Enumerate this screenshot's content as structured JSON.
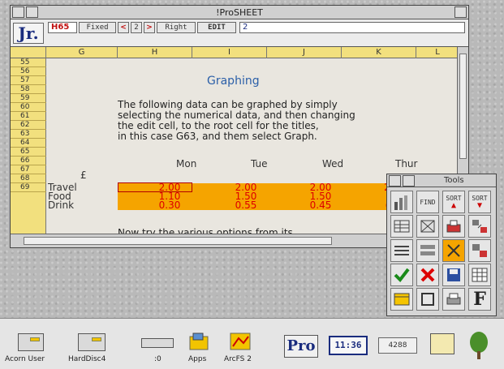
{
  "window": {
    "title": "!ProSHEET"
  },
  "infobar": {
    "logo": "Jr.",
    "cell_ref": "H65",
    "format_fixed": "Fixed",
    "arrow_left": "<",
    "decimals": "2",
    "arrow_right": ">",
    "align": "Right",
    "edit_label": "EDIT",
    "edit_value": "2"
  },
  "columns": [
    "G",
    "H",
    "I",
    "J",
    "K",
    "L"
  ],
  "rows": [
    "55",
    "56",
    "57",
    "58",
    "59",
    "60",
    "61",
    "62",
    "63",
    "64",
    "65",
    "66",
    "67",
    "68",
    "69"
  ],
  "sheet": {
    "heading": "Graphing",
    "paragraph": [
      "The following data can be graphed by simply",
      "selecting the numerical data, and then changing",
      "the edit cell, to the root cell for the titles,",
      "in this case G63, and them select Graph."
    ],
    "days": [
      "Mon",
      "Tue",
      "Wed",
      "Thur"
    ],
    "currency": "£",
    "categories": [
      {
        "label": "Travel",
        "values": [
          "2.00",
          "2.00",
          "2.00",
          "2"
        ]
      },
      {
        "label": "Food",
        "values": [
          "1.10",
          "1.50",
          "1.50",
          ""
        ]
      },
      {
        "label": "Drink",
        "values": [
          "0.30",
          "0.55",
          "0.45",
          "("
        ]
      }
    ],
    "truncated_line": "Now try the various options from its"
  },
  "colors": {
    "highlight": "#f5a400",
    "value_text": "#d00000",
    "heading": "#2b5fa8",
    "header_bg": "#f2e07e"
  },
  "tools": {
    "title": "Tools",
    "find": "FIND",
    "sort": "SORT",
    "items": [
      "bar-chart-icon",
      "find-button",
      "sort-ascending-button",
      "sort-descending-button",
      "insert-rows-icon",
      "delete-columns-icon",
      "insert-cells-icon",
      "move-cells-icon",
      "format-columns-icon",
      "justify-icon",
      "clear-icon",
      "copy-cells-icon",
      "tick-icon",
      "cross-icon",
      "save-disc-icon",
      "table-icon",
      "window-icon",
      "box-icon",
      "print-icon",
      "font-icon"
    ]
  },
  "iconbar": {
    "acorn_user": "Acorn User",
    "harddisc": "HardDisc4",
    "ram": ":0",
    "apps": "Apps",
    "arcfs": "ArcFS 2",
    "pro": "Pro",
    "clock": "11:36",
    "memory": "4288"
  }
}
